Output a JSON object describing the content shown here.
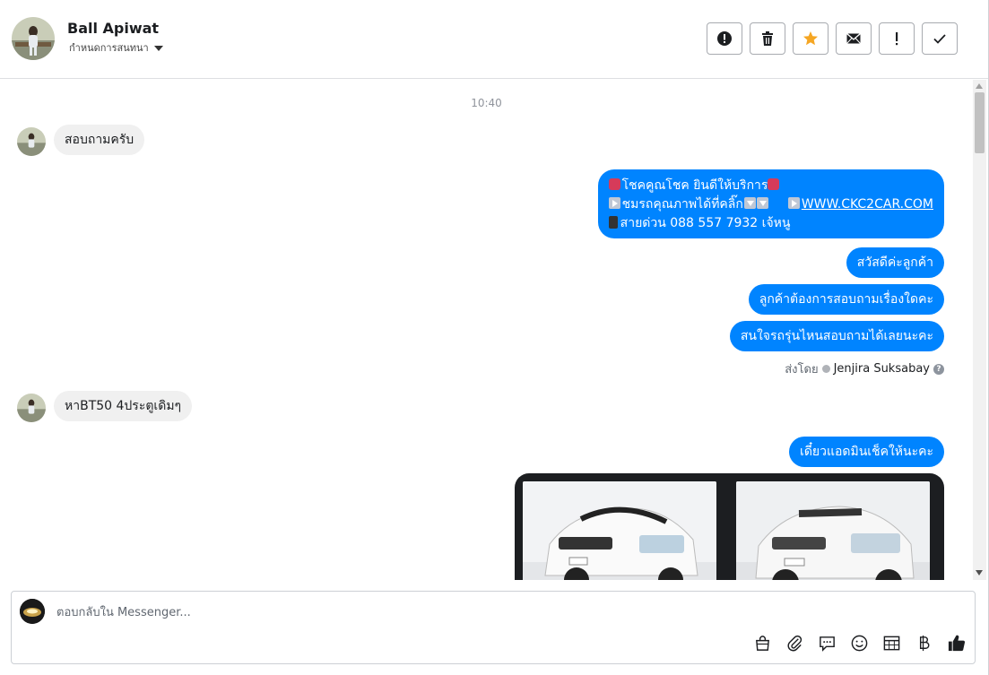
{
  "header": {
    "contact_name": "Ball Apiwat",
    "assign_label": "กำหนดการสนทนา"
  },
  "toolbar": {
    "buttons": [
      {
        "name": "report-button",
        "icon": "alert-circle-icon"
      },
      {
        "name": "delete-button",
        "icon": "trash-icon"
      },
      {
        "name": "star-button",
        "icon": "star-icon"
      },
      {
        "name": "mark-unread-button",
        "icon": "envelope-icon"
      },
      {
        "name": "important-button",
        "icon": "exclamation-icon"
      },
      {
        "name": "done-button",
        "icon": "checkmark-icon"
      }
    ]
  },
  "conversation": {
    "timestamp": "10:40",
    "messages": {
      "in1": "สอบถามครับ",
      "auto_line1": "โชคคูณโชค ยินดีให้บริการ",
      "auto_line2": "ชมรถคุณภาพได้ที่คลิ๊ก",
      "auto_link": "WWW.CKC2CAR.COM",
      "auto_line3": "สายด่วน 088 557 7932 เจ้หนู",
      "out2": "สวัสดีค่ะลูกค้า",
      "out3": "ลูกค้าต้องการสอบถามเรื่องใดคะ",
      "out4": "สนใจรถรุ่นไหนสอบถามได้เลยนะคะ",
      "in2": "หาBT50 4ประตูเดิมๆ",
      "out5": "เดี๋ยวแอดมินเช็คให้นะคะ"
    },
    "sent_by_label": "ส่งโดย",
    "sent_by_name": "Jenjira Suksabay"
  },
  "composer": {
    "placeholder": "ตอบกลับใน Messenger...",
    "tools": [
      "shopping-bag-icon",
      "paperclip-icon",
      "saved-reply-icon",
      "emoji-icon",
      "table-icon",
      "baht-icon",
      "thumbs-up-icon"
    ]
  },
  "colors": {
    "outgoing_bubble": "#0084ff",
    "incoming_bubble": "#f0f0f0",
    "star": "#f5a623"
  }
}
